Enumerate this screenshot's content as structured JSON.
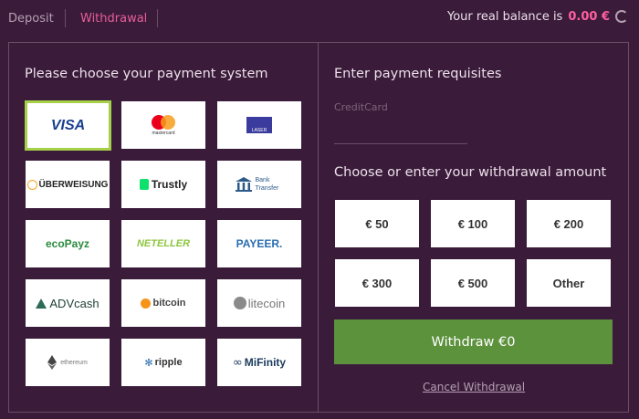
{
  "tabs": {
    "deposit": "Deposit",
    "withdrawal": "Withdrawal"
  },
  "balance": {
    "label": "Your real balance is",
    "amount": "0.00 €"
  },
  "left": {
    "title": "Please choose your payment system",
    "methods": [
      {
        "name": "VISA",
        "icon": "visa-logo",
        "selected": true
      },
      {
        "name": "mastercard",
        "icon": "mastercard-logo"
      },
      {
        "name": "LASER",
        "icon": "laser-logo"
      },
      {
        "name": "ÜBERWEISUNG",
        "icon": "ueberweisung-logo"
      },
      {
        "name": "Trustly",
        "icon": "trustly-logo"
      },
      {
        "name": "Bank Transfer",
        "icon": "bank-icon"
      },
      {
        "name": "ecoPayz",
        "icon": "ecopayz-logo"
      },
      {
        "name": "NETELLER",
        "icon": "neteller-logo"
      },
      {
        "name": "PAYEER.",
        "icon": "payeer-logo"
      },
      {
        "name": "ADVcash",
        "icon": "advcash-logo"
      },
      {
        "name": "bitcoin",
        "icon": "bitcoin-logo"
      },
      {
        "name": "litecoin",
        "icon": "litecoin-logo"
      },
      {
        "name": "ethereum",
        "icon": "ethereum-logo"
      },
      {
        "name": "ripple",
        "icon": "ripple-logo"
      },
      {
        "name": "MiFinity",
        "icon": "mifinity-logo"
      }
    ]
  },
  "right": {
    "title": "Enter payment requisites",
    "card_label": "CreditCard",
    "amount_title": "Choose or enter your withdrawal amount",
    "amounts": [
      "€ 50",
      "€ 100",
      "€ 200",
      "€ 300",
      "€ 500",
      "Other"
    ],
    "withdraw_label": "Withdraw €0",
    "cancel_label": "Cancel Withdrawal"
  },
  "colors": {
    "background": "#3a1c3a",
    "accent": "#e85d9a",
    "selected": "#a7d04a",
    "withdraw": "#5c923c"
  }
}
